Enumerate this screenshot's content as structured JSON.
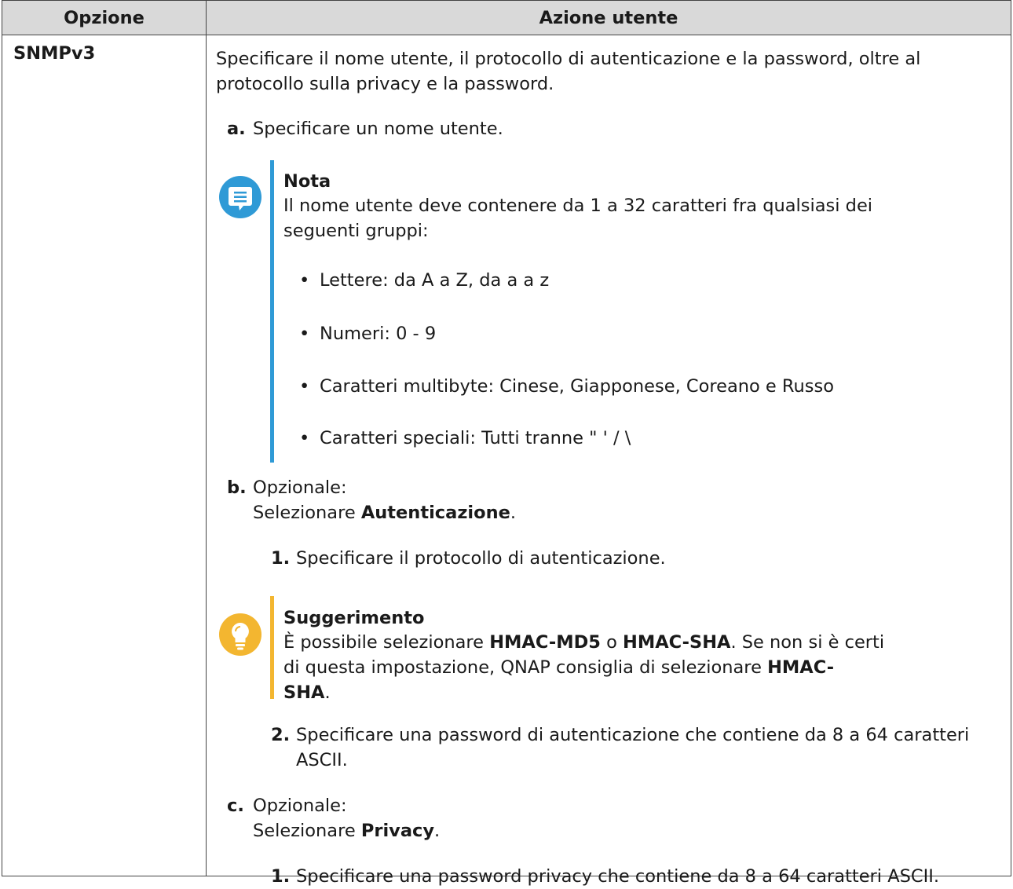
{
  "table": {
    "header_option": "Opzione",
    "header_action": "Azione utente"
  },
  "row": {
    "option": "SNMPv3",
    "intro_line1": "Specificare il nome utente, il protocollo di autenticazione e la password, oltre al",
    "intro_line2": "protocollo sulla privacy e la password.",
    "step_a": {
      "label": "a.",
      "text": "Specificare un nome utente."
    },
    "note": {
      "title": "Nota",
      "line1": "Il nome utente deve contenere da 1 a 32 caratteri fra qualsiasi dei",
      "line2": "seguenti gruppi:",
      "bullets": [
        "Lettere: da A a Z, da a a z",
        "Numeri: 0 - 9",
        "Caratteri multibyte: Cinese, Giapponese, Coreano e Russo",
        "Caratteri speciali: Tutti tranne \" ' / \\"
      ]
    },
    "step_b": {
      "label": "b.",
      "line1": "Opzionale:",
      "select_prefix": "Selezionare ",
      "select_bold": "Autenticazione",
      "select_suffix": ".",
      "sub1": {
        "label": "1.",
        "text": "Specificare il protocollo di autenticazione."
      },
      "tip": {
        "title": "Suggerimento",
        "l1_a": "È possibile selezionare ",
        "l1_b": "HMAC-MD5",
        "l1_c": " o ",
        "l1_d": "HMAC-SHA",
        "l1_e": ". Se non si è certi",
        "l2_a": "di questa impostazione, QNAP consiglia di selezionare ",
        "l2_b": "HMAC-",
        "l3_a": "SHA",
        "l3_b": "."
      },
      "sub2": {
        "label": "2.",
        "line1": "Specificare una password di autenticazione che contiene da 8 a 64 caratteri",
        "line2": "ASCII."
      }
    },
    "step_c": {
      "label": "c.",
      "line1": "Opzionale:",
      "select_prefix": "Selezionare ",
      "select_bold": "Privacy",
      "select_suffix": ".",
      "sub1": {
        "label": "1.",
        "text": "Specificare una password privacy che contiene da 8 a 64 caratteri ASCII."
      }
    }
  },
  "colors": {
    "header_bg": "#d9d9d9",
    "note_accent": "#2f9ad6",
    "tip_accent": "#f3b630"
  }
}
